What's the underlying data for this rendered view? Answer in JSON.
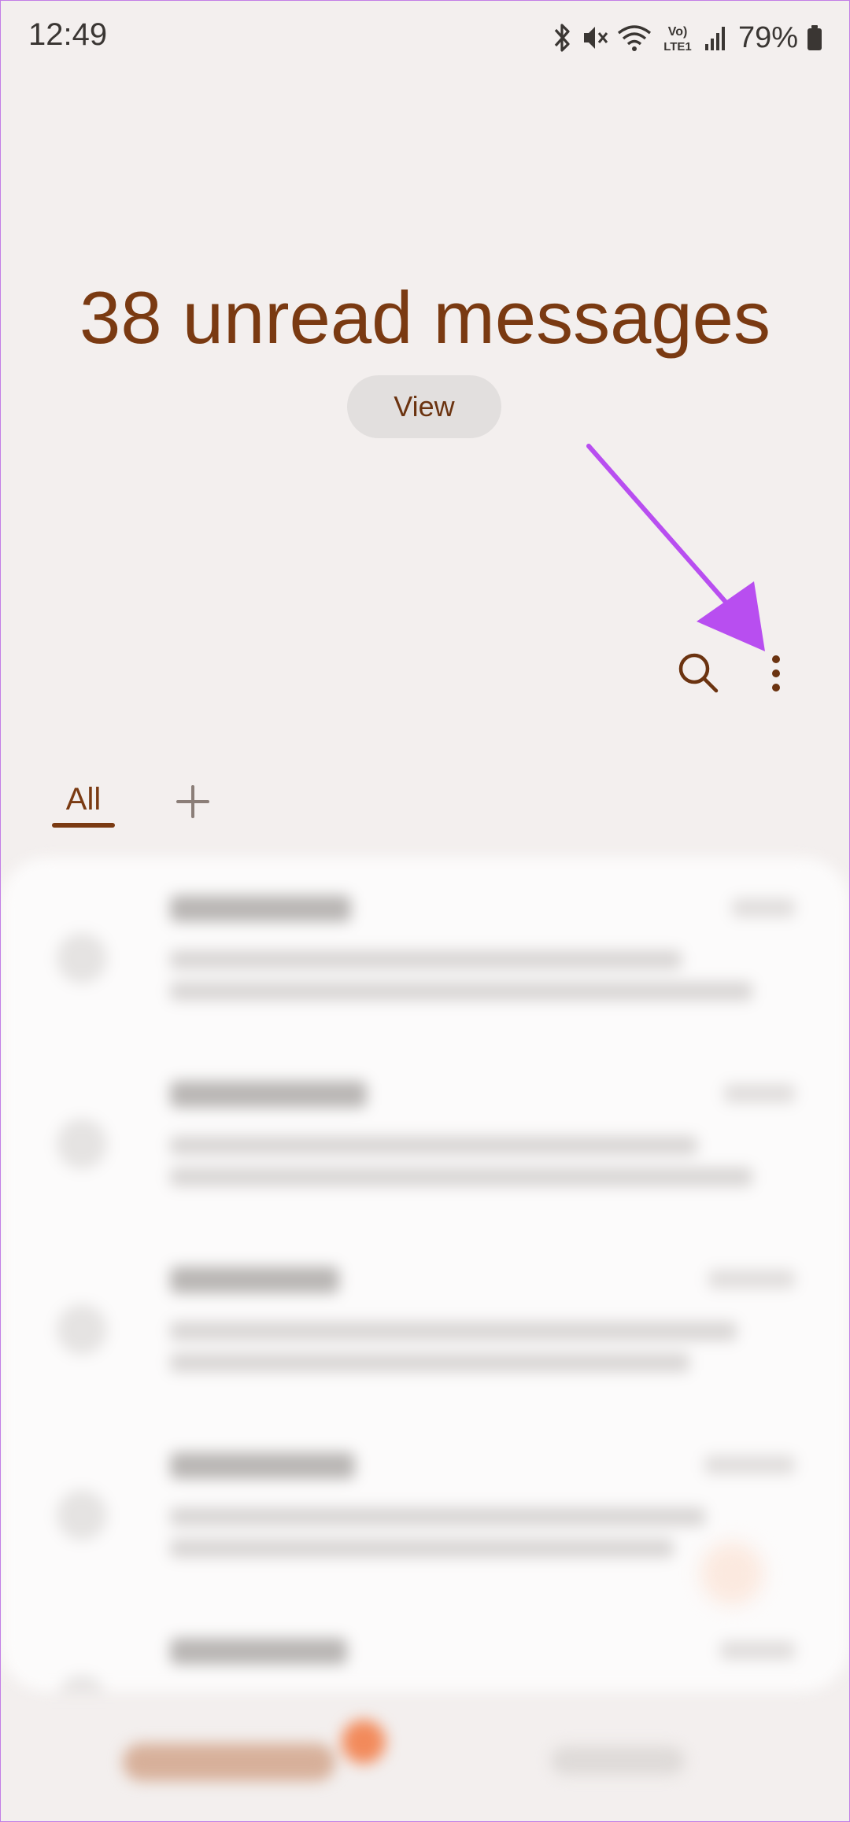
{
  "status_bar": {
    "time": "12:49",
    "battery_percent": "79%",
    "network_label": "Vo) LTE1",
    "icons": [
      "bluetooth-icon",
      "mute-icon",
      "wifi-icon",
      "volte-icon",
      "signal-icon",
      "battery-icon"
    ]
  },
  "hero": {
    "unread_title": "38 unread messages",
    "view_label": "View"
  },
  "actions": {
    "icons": [
      "search-icon",
      "more-options-icon"
    ]
  },
  "tabs": {
    "all_label": "All",
    "add_icon": "plus-icon"
  },
  "colors": {
    "accent": "#7a3a12",
    "background": "#f3efee",
    "annotation_arrow": "#b84ef0"
  }
}
